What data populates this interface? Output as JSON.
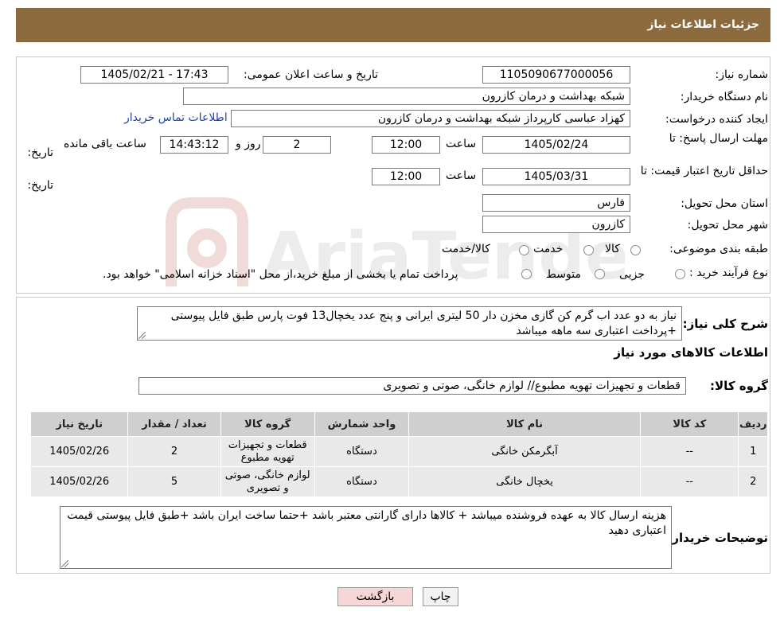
{
  "header": {
    "title": "جزئیات اطلاعات نیاز"
  },
  "form": {
    "need_number_label": "شماره نیاز:",
    "need_number": "1105090677000056",
    "announce_label": "تاریخ و ساعت اعلان عمومی:",
    "announce_value": "1405/02/21 - 17:43",
    "buyer_label": "نام دستگاه خریدار:",
    "buyer_value": "شبکه بهداشت و درمان کازرون",
    "creator_label": "ایجاد کننده درخواست:",
    "creator_value": "کهزاد عباسی کارپرداز شبکه بهداشت و درمان کازرون",
    "contact_link": "اطلاعات تماس خریدار",
    "deadline_label_1": "مهلت ارسال پاسخ: تا",
    "deadline_label_2": "تاریخ:",
    "deadline_date": "1405/02/24",
    "time_label": "ساعت",
    "deadline_time": "12:00",
    "days_value": "2",
    "days_label": "روز و",
    "remaining_time": "14:43:12",
    "remaining_label": "ساعت باقی مانده",
    "validity_label_1": "حداقل تاریخ اعتبار قیمت: تا",
    "validity_label_2": "تاریخ:",
    "validity_date": "1405/03/31",
    "validity_time_label": "ساعت",
    "validity_time": "12:00",
    "province_label": "استان محل تحویل:",
    "province_value": "فارس",
    "city_label": "شهر محل تحویل:",
    "city_value": "کازرون",
    "category_label": "طبقه بندی موضوعی:",
    "category_options": [
      "کالا",
      "خدمت",
      "کالا/خدمت"
    ],
    "process_label": "نوع فرآیند خرید :",
    "process_options": [
      "جزیی",
      "متوسط"
    ],
    "process_note": "پرداخت تمام یا بخشی از مبلغ خرید،از محل \"اسناد خزانه اسلامی\" خواهد بود."
  },
  "description": {
    "label": "شرح کلی نیاز:",
    "text": "نیاز به دو عدد اب گرم کن گازی مخزن دار 50 لیتری ایرانی  و پنج عدد یخچال13 فوت پارس  طبق فایل پیوستی +پرداخت اعتباری سه ماهه میباشد"
  },
  "items_section": {
    "title": "اطلاعات کالاهای مورد نیاز",
    "group_label": "گروه کالا:",
    "group_value": "قطعات و تجهیزات تهویه مطبوع// لوازم خانگی، صوتی و تصویری"
  },
  "table": {
    "headers": [
      "ردیف",
      "کد کالا",
      "نام کالا",
      "واحد شمارش",
      "گروه کالا",
      "تعداد / مقدار",
      "تاریخ نیاز"
    ],
    "rows": [
      {
        "row": "1",
        "code": "--",
        "name": "آبگرمکن خانگی",
        "unit": "دستگاه",
        "group": "قطعات و تجهیزات تهویه مطبوع",
        "qty": "2",
        "date": "1405/02/26"
      },
      {
        "row": "2",
        "code": "--",
        "name": "یخچال خانگی",
        "unit": "دستگاه",
        "group": "لوازم خانگی، صوتی و تصویری",
        "qty": "5",
        "date": "1405/02/26"
      }
    ]
  },
  "buyer_notes": {
    "label": "توضیحات خریدار:",
    "text": "هزینه ارسال کالا به عهده فروشنده میباشد + کالاها دارای گارانتی معتبر باشد +حتما ساخت ایران باشد +طبق فایل پیوستی قیمت اعتباری دهید"
  },
  "buttons": {
    "print": "چاپ",
    "back": "بازگشت"
  },
  "watermark": {
    "text": "AriaTender.neT"
  },
  "colors": {
    "header": "#8b6a3e",
    "link": "#1f3fb5",
    "back_button": "#f6d6d6",
    "table_header": "#cfcfcf",
    "table_row": "#e9e9e9"
  }
}
